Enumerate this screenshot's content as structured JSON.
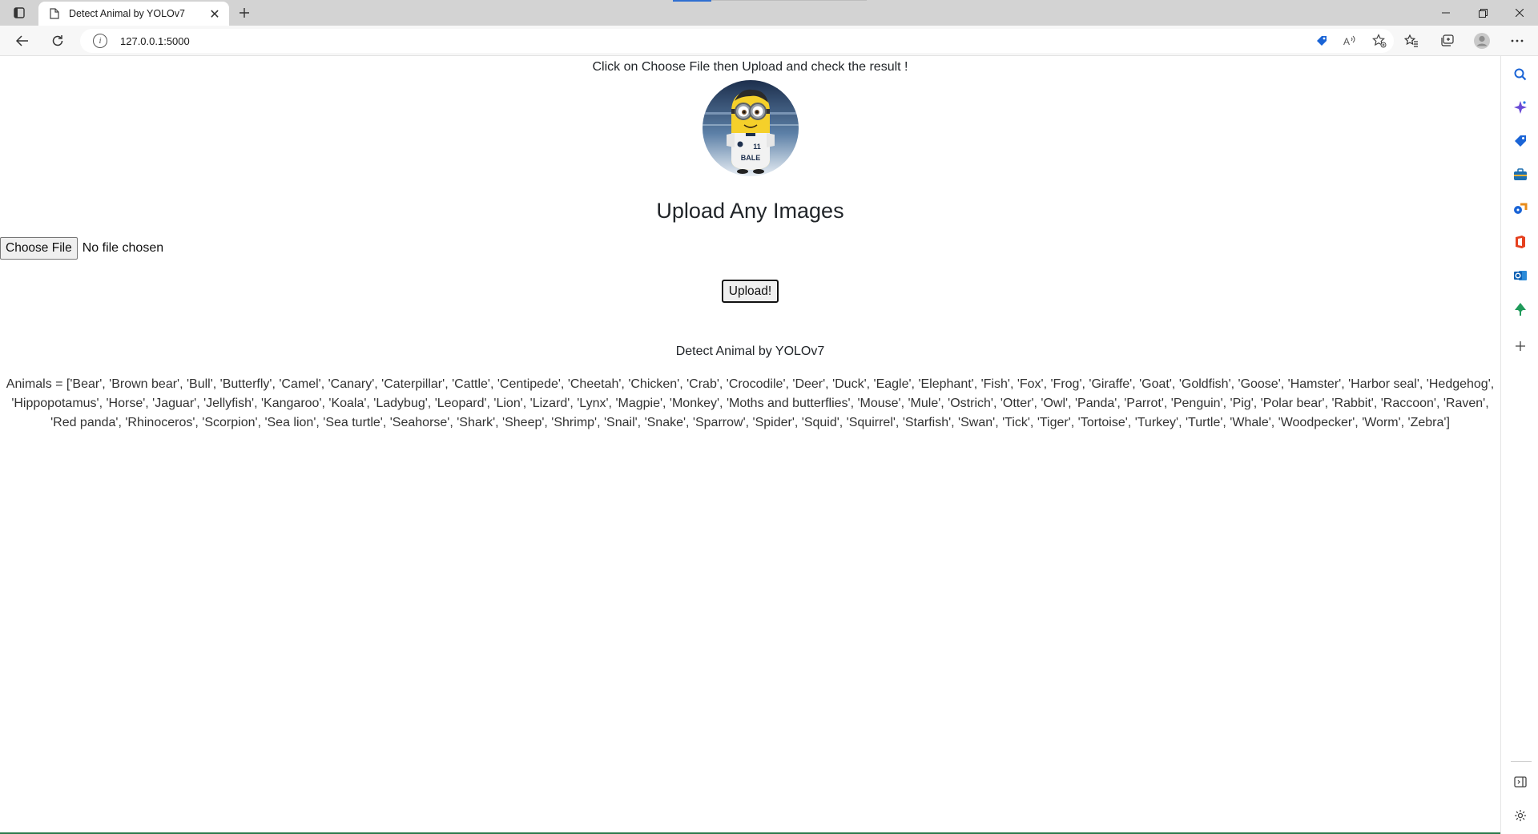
{
  "browser": {
    "tab_title": "Detect Animal by YOLOv7",
    "address": "127.0.0.1:5000"
  },
  "page": {
    "instruction": "Click on Choose File then Upload and check the result !",
    "avatar_badge": "BALE",
    "heading": "Upload Any Images",
    "choose_file_label": "Choose File",
    "file_status": "No file chosen",
    "upload_label": "Upload!",
    "subtitle": "Detect Animal by YOLOv7",
    "animals_text": "Animals = ['Bear', 'Brown bear', 'Bull', 'Butterfly', 'Camel', 'Canary', 'Caterpillar', 'Cattle', 'Centipede', 'Cheetah', 'Chicken', 'Crab', 'Crocodile', 'Deer', 'Duck', 'Eagle', 'Elephant', 'Fish', 'Fox', 'Frog', 'Giraffe', 'Goat', 'Goldfish', 'Goose', 'Hamster', 'Harbor seal', 'Hedgehog', 'Hippopotamus', 'Horse', 'Jaguar', 'Jellyfish', 'Kangaroo', 'Koala', 'Ladybug', 'Leopard', 'Lion', 'Lizard', 'Lynx', 'Magpie', 'Monkey', 'Moths and butterflies', 'Mouse', 'Mule', 'Ostrich', 'Otter', 'Owl', 'Panda', 'Parrot', 'Penguin', 'Pig', 'Polar bear', 'Rabbit', 'Raccoon', 'Raven', 'Red panda', 'Rhinoceros', 'Scorpion', 'Sea lion', 'Sea turtle', 'Seahorse', 'Shark', 'Sheep', 'Shrimp', 'Snail', 'Snake', 'Sparrow', 'Spider', 'Squid', 'Squirrel', 'Starfish', 'Swan', 'Tick', 'Tiger', 'Tortoise', 'Turkey', 'Turtle', 'Whale', 'Woodpecker', 'Worm', 'Zebra']"
  },
  "icons": {
    "tab_actions": "tab-actions-icon",
    "favicon": "page-icon",
    "close": "close-icon",
    "new_tab": "plus-icon",
    "back": "back-arrow-icon",
    "refresh": "refresh-icon",
    "info": "info-icon",
    "tracking": "tag-icon",
    "read_aloud": "read-aloud-icon",
    "add_favorite": "add-favorite-icon",
    "favorites": "favorites-icon",
    "collections": "collections-icon",
    "profile": "profile-icon",
    "more": "more-icon",
    "sidebar": [
      "search-icon",
      "copilot-icon",
      "shopping-icon",
      "tools-icon",
      "games-icon",
      "office-icon",
      "outlook-icon",
      "tree-icon",
      "add-icon",
      "sidebar-toggle-icon",
      "settings-icon"
    ]
  },
  "colors": {
    "accent_blue": "#2f6fd1",
    "bottom_edge": "#2b7a4b"
  }
}
